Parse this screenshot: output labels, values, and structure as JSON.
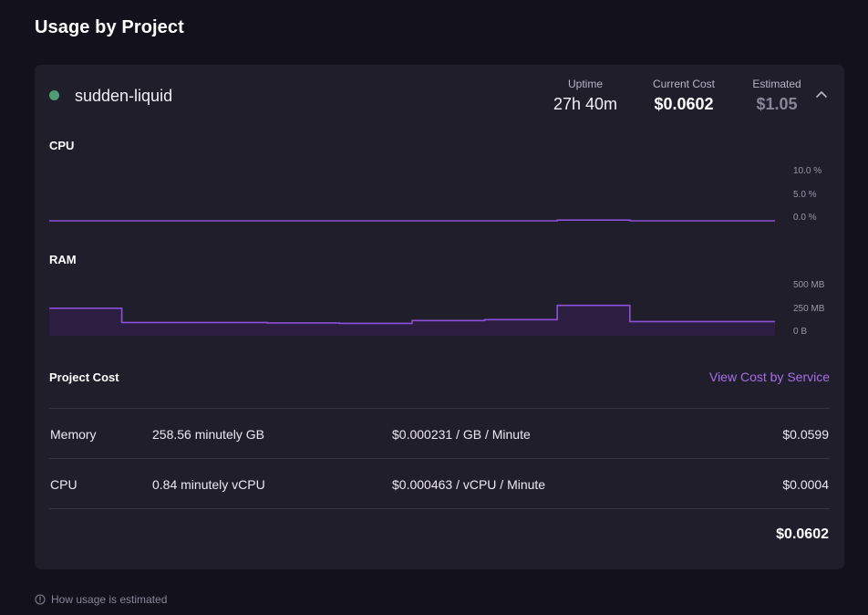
{
  "page": {
    "title": "Usage by Project"
  },
  "project": {
    "name": "sudden-liquid",
    "status_color": "#4f9c73",
    "stats": {
      "uptime_label": "Uptime",
      "uptime_value": "27h 40m",
      "current_cost_label": "Current Cost",
      "current_cost_value": "$0.0602",
      "estimated_label": "Estimated",
      "estimated_value": "$1.05"
    }
  },
  "charts": {
    "cpu": {
      "label": "CPU",
      "ticks": [
        "10.0 %",
        "5.0 %",
        "0.0 %"
      ]
    },
    "ram": {
      "label": "RAM",
      "ticks": [
        "500 MB",
        "250 MB",
        "0 B"
      ]
    }
  },
  "chart_data": [
    {
      "type": "line",
      "title": "CPU",
      "x": [
        0,
        1,
        2,
        3,
        4,
        5,
        6,
        7,
        8,
        9
      ],
      "series": [
        {
          "values": [
            0.0,
            0.0,
            0.0,
            0.0,
            0.0,
            0.0,
            0.0,
            0.15,
            0.0,
            0.0
          ]
        }
      ],
      "ylim": [
        0,
        10
      ],
      "yticks": [
        "0.0 %",
        "5.0 %",
        "10.0 %"
      ],
      "color": "#8b4fd8",
      "grid": false
    },
    {
      "type": "area",
      "title": "RAM",
      "x": [
        0,
        1,
        2,
        3,
        4,
        5,
        6,
        7,
        8,
        9
      ],
      "series": [
        {
          "values": [
            290,
            140,
            140,
            135,
            130,
            160,
            170,
            320,
            150,
            150
          ]
        }
      ],
      "ylim": [
        0,
        500
      ],
      "yticks": [
        "0 B",
        "250 MB",
        "500 MB"
      ],
      "color": "#8b4fd8",
      "grid": false
    }
  ],
  "cost": {
    "section_label": "Project Cost",
    "view_link": "View Cost by Service",
    "rows": [
      {
        "name": "Memory",
        "quantity": "258.56 minutely GB",
        "rate": "$0.000231 / GB / Minute",
        "amount": "$0.0599"
      },
      {
        "name": "CPU",
        "quantity": "0.84 minutely vCPU",
        "rate": "$0.000463 / vCPU / Minute",
        "amount": "$0.0004"
      }
    ],
    "total": "$0.0602"
  },
  "footer": {
    "help_text": "How usage is estimated",
    "icon": "info-circle-icon"
  },
  "colors": {
    "background": "#13111c",
    "card": "#201e2b",
    "accent": "#a66ee6",
    "chart_line": "#8b4fd8"
  }
}
